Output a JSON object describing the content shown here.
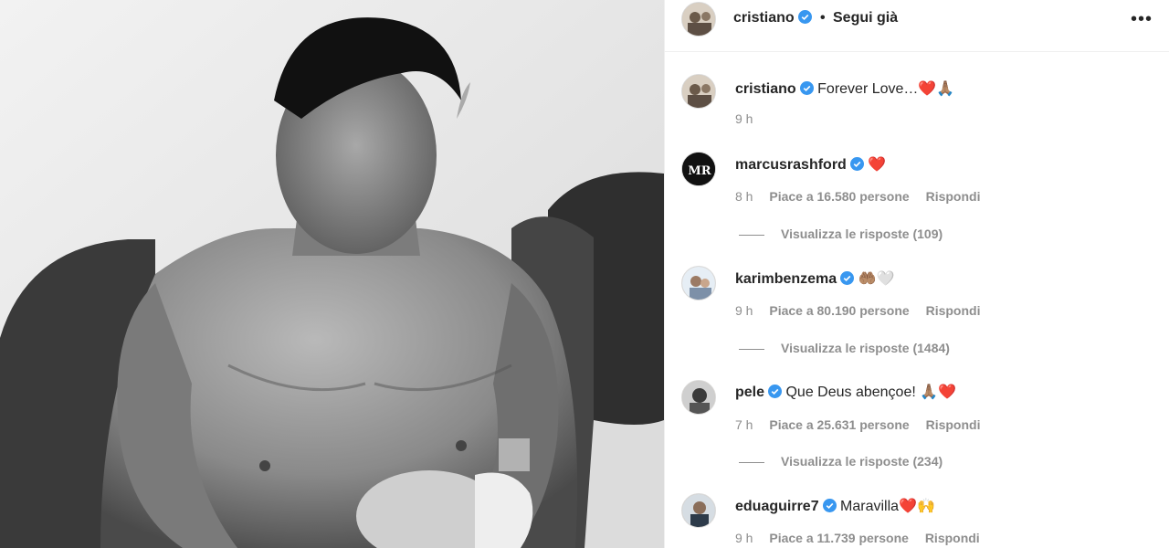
{
  "post": {
    "author": "cristiano",
    "follow_state": "Segui già",
    "separator": "•",
    "caption": {
      "username": "cristiano",
      "text": "Forever Love…",
      "emoji": "❤️🙏🏽",
      "time": "9 h"
    }
  },
  "comments": [
    {
      "username": "marcusrashford",
      "text": "",
      "emoji": "❤️",
      "time": "8 h",
      "likes": "Piace a 16.580 persone",
      "reply": "Rispondi",
      "replies": "Visualizza le risposte (109)"
    },
    {
      "username": "karimbenzema",
      "text": "",
      "emoji": "🤲🏽🤍",
      "time": "9 h",
      "likes": "Piace a 80.190 persone",
      "reply": "Rispondi",
      "replies": "Visualizza le risposte (1484)"
    },
    {
      "username": "pele",
      "text": "Que Deus abençoe!",
      "emoji": "🙏🏽❤️",
      "time": "7 h",
      "likes": "Piace a 25.631 persone",
      "reply": "Rispondi",
      "replies": "Visualizza le risposte (234)"
    },
    {
      "username": "eduaguirre7",
      "text": "Maravilla",
      "emoji": "❤️🙌",
      "time": "9 h",
      "likes": "Piace a 11.739 persone",
      "reply": "Rispondi",
      "replies": ""
    }
  ],
  "icons": {
    "verified": "verified-badge-icon",
    "more": "more-options-icon"
  },
  "colors": {
    "verified": "#3897f0",
    "heart": "#e0112b",
    "secondary_text": "#8e8e8e"
  }
}
